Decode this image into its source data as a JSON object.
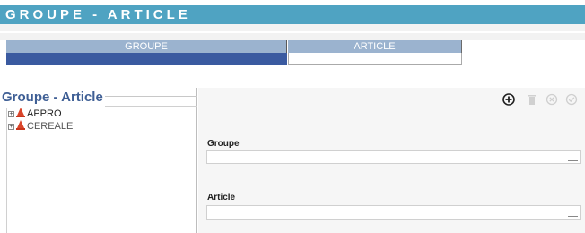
{
  "title": "GROUPE - ARTICLE",
  "tabs": [
    {
      "label": "GROUPE"
    },
    {
      "label": "ARTICLE"
    }
  ],
  "left_panel": {
    "title": "Groupe - Article",
    "tree": [
      {
        "label": "APPRO"
      },
      {
        "label": "CEREALE"
      }
    ]
  },
  "form": {
    "groupe": {
      "label": "Groupe",
      "value": ""
    },
    "article": {
      "label": "Article",
      "value": ""
    }
  },
  "colors": {
    "title_bar": "#4fa3c2",
    "tab_header": "#9bb3cf",
    "tab_active": "#3a5aa0",
    "panel_title": "#3f5f95"
  },
  "toolbar_icons": [
    "add-icon",
    "delete-icon",
    "cancel-icon",
    "confirm-icon"
  ]
}
